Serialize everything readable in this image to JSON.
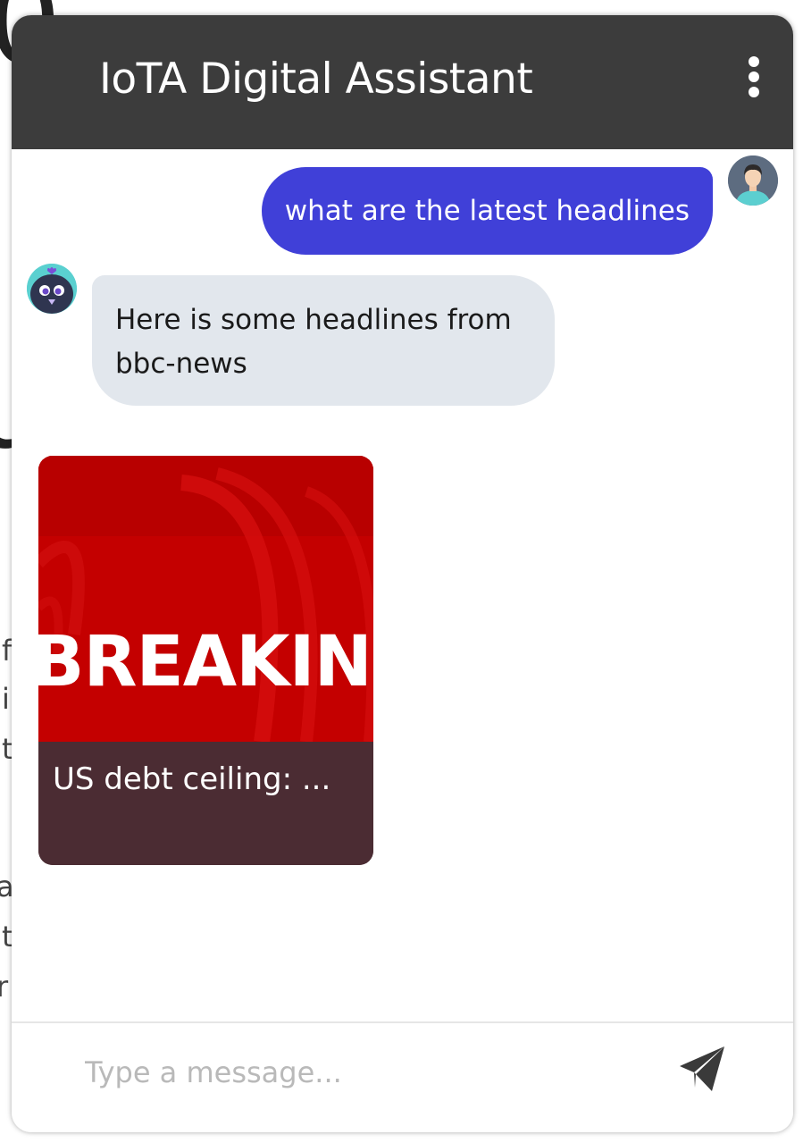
{
  "widget": {
    "title": "IoTA Digital Assistant",
    "menu_icon": "kebab-menu-icon"
  },
  "messages": {
    "user_message": "what are the latest headlines",
    "bot_message": "Here is some headlines from bbc-news",
    "user_avatar_icon": "user-avatar-icon",
    "bot_avatar_icon": "bot-avatar-icon"
  },
  "news_card": {
    "image_text": "BREAKING",
    "title": "US debt ceiling: ..."
  },
  "composer": {
    "placeholder": "Type a message...",
    "send_icon": "send-icon"
  },
  "colors": {
    "header_bg": "#3c3c3c",
    "user_bubble": "#4040d8",
    "bot_bubble": "#e2e7ed",
    "card_image": "#c40000",
    "card_caption": "#4b2c33"
  }
}
